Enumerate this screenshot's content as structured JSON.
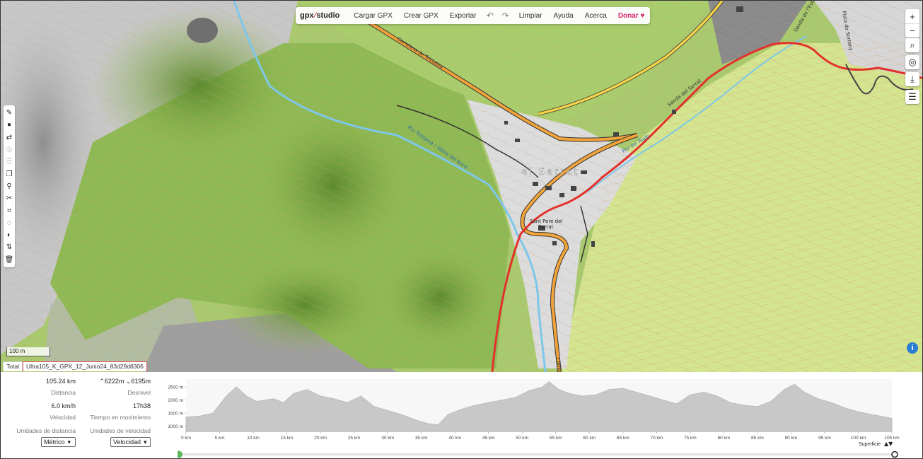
{
  "app": {
    "logo": {
      "prefix": "gpx",
      "suffix": "studio"
    },
    "menu": [
      "Cargar GPX",
      "Crear GPX",
      "Exportar",
      "Limpiar",
      "Ayuda",
      "Acerca"
    ],
    "donate": "Donar"
  },
  "map": {
    "scale_label": "100 m",
    "place_labels": {
      "village": "el Serrat",
      "church_line1": "Sant Pere del",
      "church_line2": "Serrat"
    },
    "road_labels": [
      "Carretera de Tristaina",
      "Riu Tristaina / Valira del Nord",
      "Riu del Rialb",
      "Senda del Serrat",
      "Carrera",
      "Senda de l'Estany",
      "Pista de Sorteny"
    ],
    "accent_colors": {
      "track": "#e3302b",
      "road_main": "#f2a33a",
      "road_yellow": "#f5d34a",
      "river": "#7ec7e8"
    }
  },
  "tabs": {
    "total": "Total",
    "file": "Ultra105_K_GPX_12_Junio24_83d29d8306"
  },
  "stats": {
    "distance_value": "105.24 km",
    "distance_label": "Distancia",
    "elev_up": "6222m",
    "elev_down": "6195m",
    "elev_label": "Desnivel",
    "speed_value": "6.0 km/h",
    "speed_label": "Velocidad",
    "moving_time_value": "17h38",
    "moving_time_label": "Tiempo en movimiento",
    "dist_units_label": "Unidades de distancia",
    "speed_units_label": "Unidades de velocidad",
    "dist_units_value": "Métrico",
    "speed_units_value": "Velocidad"
  },
  "profile_controls": {
    "surface_label": "Superficie"
  },
  "chart_data": {
    "type": "area",
    "title": "",
    "xlabel": "",
    "ylabel": "",
    "x_unit": "km",
    "xlim": [
      0,
      105
    ],
    "ylim": [
      800,
      2800
    ],
    "x_ticks": [
      "0 km",
      "5 km",
      "10 km",
      "15 km",
      "20 km",
      "25 km",
      "30 km",
      "35 km",
      "40 km",
      "45 km",
      "50 km",
      "55 km",
      "60 km",
      "65 km",
      "70 km",
      "75 km",
      "80 km",
      "85 km",
      "90 km",
      "95 km",
      "100 km",
      "105 km"
    ],
    "y_ticks": [
      "1000 m",
      "1500 m",
      "2000 m",
      "2500 m"
    ],
    "x": [
      0,
      2,
      4,
      6,
      7.5,
      9,
      10.5,
      13,
      14.5,
      16,
      18,
      20,
      22,
      24,
      26,
      28,
      30,
      32,
      34,
      36,
      37.5,
      39,
      41,
      43,
      45,
      47,
      49,
      51,
      53,
      54,
      55.5,
      57,
      59,
      61,
      63,
      65,
      67,
      69,
      71,
      73,
      75,
      77,
      79,
      81,
      83,
      85,
      87,
      89,
      90.5,
      92,
      94,
      96,
      98,
      100,
      102,
      105
    ],
    "y": [
      1350,
      1380,
      1500,
      2150,
      2500,
      2150,
      1950,
      2050,
      1900,
      2250,
      2400,
      2150,
      2050,
      1900,
      2150,
      1750,
      1600,
      1450,
      1250,
      1100,
      1050,
      1450,
      1650,
      1800,
      1900,
      2000,
      2100,
      2350,
      2500,
      2700,
      2400,
      2250,
      2150,
      2200,
      2400,
      2450,
      2300,
      2150,
      2000,
      1850,
      2200,
      2300,
      2150,
      1900,
      1800,
      1750,
      1950,
      2400,
      2600,
      2300,
      2050,
      1900,
      1700,
      1550,
      1450,
      1300
    ],
    "grid": false,
    "legend": "none"
  }
}
